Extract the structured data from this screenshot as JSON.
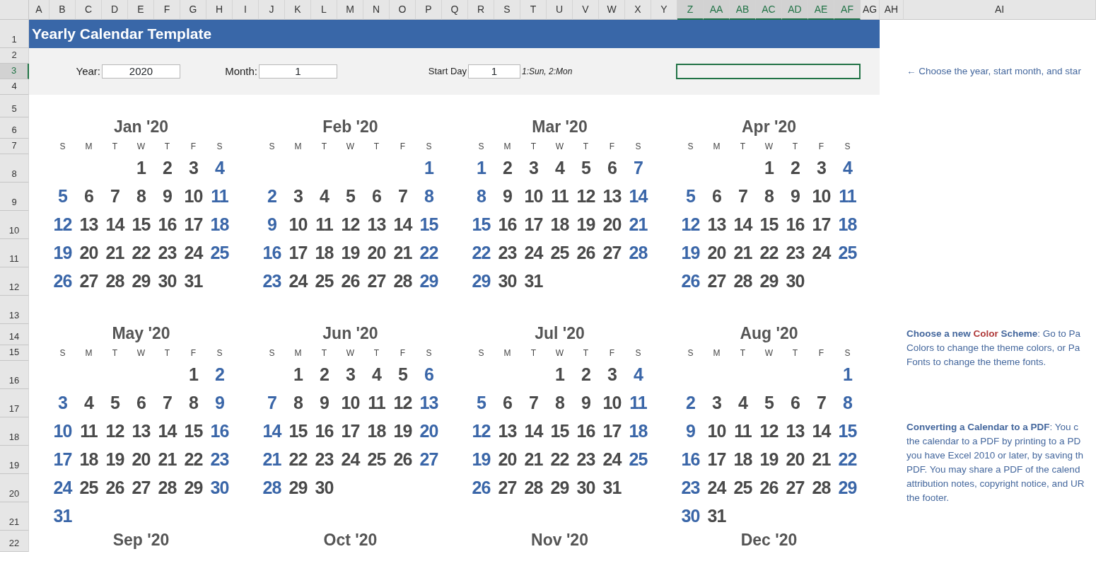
{
  "sheet": {
    "columns": [
      {
        "label": "A",
        "selected": false
      },
      {
        "label": "B",
        "selected": false
      },
      {
        "label": "C",
        "selected": false
      },
      {
        "label": "D",
        "selected": false
      },
      {
        "label": "E",
        "selected": false
      },
      {
        "label": "F",
        "selected": false
      },
      {
        "label": "G",
        "selected": false
      },
      {
        "label": "H",
        "selected": false
      },
      {
        "label": "I",
        "selected": false
      },
      {
        "label": "J",
        "selected": false
      },
      {
        "label": "K",
        "selected": false
      },
      {
        "label": "L",
        "selected": false
      },
      {
        "label": "M",
        "selected": false
      },
      {
        "label": "N",
        "selected": false
      },
      {
        "label": "O",
        "selected": false
      },
      {
        "label": "P",
        "selected": false
      },
      {
        "label": "Q",
        "selected": false
      },
      {
        "label": "R",
        "selected": false
      },
      {
        "label": "S",
        "selected": false
      },
      {
        "label": "T",
        "selected": false
      },
      {
        "label": "U",
        "selected": false
      },
      {
        "label": "V",
        "selected": false
      },
      {
        "label": "W",
        "selected": false
      },
      {
        "label": "X",
        "selected": false
      },
      {
        "label": "Y",
        "selected": false
      },
      {
        "label": "Z",
        "selected": true
      },
      {
        "label": "AA",
        "selected": true
      },
      {
        "label": "AB",
        "selected": true
      },
      {
        "label": "AC",
        "selected": true
      },
      {
        "label": "AD",
        "selected": true
      },
      {
        "label": "AE",
        "selected": true
      },
      {
        "label": "AF",
        "selected": true
      },
      {
        "label": "AG",
        "selected": false
      },
      {
        "label": "AH",
        "selected": false
      },
      {
        "label": "AI",
        "selected": false
      }
    ],
    "rows": [
      {
        "label": "1",
        "selected": false
      },
      {
        "label": "2",
        "selected": false
      },
      {
        "label": "3",
        "selected": true
      },
      {
        "label": "4",
        "selected": false
      },
      {
        "label": "5",
        "selected": false
      },
      {
        "label": "6",
        "selected": false
      },
      {
        "label": "7",
        "selected": false
      },
      {
        "label": "8",
        "selected": false
      },
      {
        "label": "9",
        "selected": false
      },
      {
        "label": "10",
        "selected": false
      },
      {
        "label": "11",
        "selected": false
      },
      {
        "label": "12",
        "selected": false
      },
      {
        "label": "13",
        "selected": false
      },
      {
        "label": "14",
        "selected": false
      },
      {
        "label": "15",
        "selected": false
      },
      {
        "label": "16",
        "selected": false
      },
      {
        "label": "17",
        "selected": false
      },
      {
        "label": "18",
        "selected": false
      },
      {
        "label": "19",
        "selected": false
      },
      {
        "label": "20",
        "selected": false
      },
      {
        "label": "21",
        "selected": false
      },
      {
        "label": "22",
        "selected": false
      }
    ]
  },
  "title": "Yearly Calendar Template",
  "inputs": [
    {
      "label": "Year:",
      "value": "2020"
    },
    {
      "label": "Month:",
      "value": "1"
    },
    {
      "label": "Start Day",
      "value": "1",
      "hint": "1:Sun, 2:Mon"
    }
  ],
  "notes": [
    {
      "parts": [
        {
          "text": "← Choose the year, start month, and star"
        }
      ]
    },
    {
      "lines": [
        {
          "parts": [
            {
              "text": "Choose a new ",
              "kind": "bold"
            },
            {
              "text": "Color",
              "kind": "accent"
            },
            {
              "text": " Scheme",
              "kind": "bold"
            },
            {
              "text": ": Go to Pa"
            }
          ]
        },
        {
          "parts": [
            {
              "text": "Colors to change the theme colors, or Pa"
            }
          ]
        },
        {
          "parts": [
            {
              "text": "Fonts to change the theme fonts."
            }
          ]
        }
      ]
    },
    {
      "lines": [
        {
          "parts": [
            {
              "text": "Converting a Calendar to a PDF",
              "kind": "bold"
            },
            {
              "text": ": You c"
            }
          ]
        },
        {
          "parts": [
            {
              "text": "the calendar to a PDF by printing to a PD"
            }
          ]
        },
        {
          "parts": [
            {
              "text": "you have Excel 2010 or later, by saving th"
            }
          ]
        },
        {
          "parts": [
            {
              "text": "PDF. You may share a PDF of the calend"
            }
          ]
        },
        {
          "parts": [
            {
              "text": "attribution notes, copyright notice, and UR"
            }
          ]
        },
        {
          "parts": [
            {
              "text": "the footer."
            }
          ]
        }
      ]
    }
  ],
  "months": [
    {
      "title": "Jan '20",
      "weekdays": [
        "S",
        "M",
        "T",
        "W",
        "T",
        "F",
        "S"
      ],
      "weeks": [
        {
          "kind": "first",
          "days": [
            "1",
            "2",
            "3",
            "4"
          ]
        },
        {
          "kind": "regular",
          "days": [
            "5",
            "6",
            "7",
            "8",
            "9",
            "10",
            "11"
          ]
        },
        {
          "kind": "regular",
          "days": [
            "12",
            "13",
            "14",
            "15",
            "16",
            "17",
            "18"
          ]
        },
        {
          "kind": "regular",
          "days": [
            "19",
            "20",
            "21",
            "22",
            "23",
            "24",
            "25"
          ]
        },
        {
          "kind": "regular",
          "days": [
            "26",
            "27",
            "28",
            "29",
            "30",
            "31"
          ]
        }
      ]
    },
    {
      "title": "Feb '20",
      "weekdays": [
        "S",
        "M",
        "T",
        "W",
        "T",
        "F",
        "S"
      ],
      "weeks": [
        {
          "kind": "first",
          "days": [
            "1"
          ]
        },
        {
          "kind": "regular",
          "days": [
            "2",
            "3",
            "4",
            "5",
            "6",
            "7",
            "8"
          ]
        },
        {
          "kind": "regular",
          "days": [
            "9",
            "10",
            "11",
            "12",
            "13",
            "14",
            "15"
          ]
        },
        {
          "kind": "regular",
          "days": [
            "16",
            "17",
            "18",
            "19",
            "20",
            "21",
            "22"
          ]
        },
        {
          "kind": "regular",
          "days": [
            "23",
            "24",
            "25",
            "26",
            "27",
            "28",
            "29"
          ]
        }
      ]
    },
    {
      "title": "Mar '20",
      "weekdays": [
        "S",
        "M",
        "T",
        "W",
        "T",
        "F",
        "S"
      ],
      "weeks": [
        {
          "kind": "first",
          "days": [
            "1",
            "2",
            "3",
            "4",
            "5",
            "6",
            "7"
          ]
        },
        {
          "kind": "regular",
          "days": [
            "8",
            "9",
            "10",
            "11",
            "12",
            "13",
            "14"
          ]
        },
        {
          "kind": "regular",
          "days": [
            "15",
            "16",
            "17",
            "18",
            "19",
            "20",
            "21"
          ]
        },
        {
          "kind": "regular",
          "days": [
            "22",
            "23",
            "24",
            "25",
            "26",
            "27",
            "28"
          ]
        },
        {
          "kind": "regular",
          "days": [
            "29",
            "30",
            "31"
          ]
        }
      ]
    },
    {
      "title": "Apr '20",
      "weekdays": [
        "S",
        "M",
        "T",
        "W",
        "T",
        "F",
        "S"
      ],
      "weeks": [
        {
          "kind": "first",
          "days": [
            "1",
            "2",
            "3",
            "4"
          ]
        },
        {
          "kind": "regular",
          "days": [
            "5",
            "6",
            "7",
            "8",
            "9",
            "10",
            "11"
          ]
        },
        {
          "kind": "regular",
          "days": [
            "12",
            "13",
            "14",
            "15",
            "16",
            "17",
            "18"
          ]
        },
        {
          "kind": "regular",
          "days": [
            "19",
            "20",
            "21",
            "22",
            "23",
            "24",
            "25"
          ]
        },
        {
          "kind": "regular",
          "days": [
            "26",
            "27",
            "28",
            "29",
            "30"
          ]
        }
      ]
    },
    {
      "title": "May '20",
      "weekdays": [
        "S",
        "M",
        "T",
        "W",
        "T",
        "F",
        "S"
      ],
      "weeks": [
        {
          "kind": "first",
          "days": [
            "1",
            "2"
          ]
        },
        {
          "kind": "regular",
          "days": [
            "3",
            "4",
            "5",
            "6",
            "7",
            "8",
            "9"
          ]
        },
        {
          "kind": "regular",
          "days": [
            "10",
            "11",
            "12",
            "13",
            "14",
            "15",
            "16"
          ]
        },
        {
          "kind": "regular",
          "days": [
            "17",
            "18",
            "19",
            "20",
            "21",
            "22",
            "23"
          ]
        },
        {
          "kind": "regular",
          "days": [
            "24",
            "25",
            "26",
            "27",
            "28",
            "29",
            "30"
          ]
        },
        {
          "kind": "regular",
          "days": [
            "31"
          ]
        }
      ]
    },
    {
      "title": "Jun '20",
      "weekdays": [
        "S",
        "M",
        "T",
        "W",
        "T",
        "F",
        "S"
      ],
      "weeks": [
        {
          "kind": "first",
          "days": [
            "1",
            "2",
            "3",
            "4",
            "5",
            "6"
          ]
        },
        {
          "kind": "regular",
          "days": [
            "7",
            "8",
            "9",
            "10",
            "11",
            "12",
            "13"
          ]
        },
        {
          "kind": "regular",
          "days": [
            "14",
            "15",
            "16",
            "17",
            "18",
            "19",
            "20"
          ]
        },
        {
          "kind": "regular",
          "days": [
            "21",
            "22",
            "23",
            "24",
            "25",
            "26",
            "27"
          ]
        },
        {
          "kind": "regular",
          "days": [
            "28",
            "29",
            "30"
          ]
        }
      ]
    },
    {
      "title": "Jul '20",
      "weekdays": [
        "S",
        "M",
        "T",
        "W",
        "T",
        "F",
        "S"
      ],
      "weeks": [
        {
          "kind": "first",
          "days": [
            "1",
            "2",
            "3",
            "4"
          ]
        },
        {
          "kind": "regular",
          "days": [
            "5",
            "6",
            "7",
            "8",
            "9",
            "10",
            "11"
          ]
        },
        {
          "kind": "regular",
          "days": [
            "12",
            "13",
            "14",
            "15",
            "16",
            "17",
            "18"
          ]
        },
        {
          "kind": "regular",
          "days": [
            "19",
            "20",
            "21",
            "22",
            "23",
            "24",
            "25"
          ]
        },
        {
          "kind": "regular",
          "days": [
            "26",
            "27",
            "28",
            "29",
            "30",
            "31"
          ]
        }
      ]
    },
    {
      "title": "Aug '20",
      "weekdays": [
        "S",
        "M",
        "T",
        "W",
        "T",
        "F",
        "S"
      ],
      "weeks": [
        {
          "kind": "first",
          "days": [
            "1"
          ]
        },
        {
          "kind": "regular",
          "days": [
            "2",
            "3",
            "4",
            "5",
            "6",
            "7",
            "8"
          ]
        },
        {
          "kind": "regular",
          "days": [
            "9",
            "10",
            "11",
            "12",
            "13",
            "14",
            "15"
          ]
        },
        {
          "kind": "regular",
          "days": [
            "16",
            "17",
            "18",
            "19",
            "20",
            "21",
            "22"
          ]
        },
        {
          "kind": "regular",
          "days": [
            "23",
            "24",
            "25",
            "26",
            "27",
            "28",
            "29"
          ]
        },
        {
          "kind": "regular",
          "days": [
            "30",
            "31"
          ]
        }
      ]
    },
    {
      "title": "Sep '20"
    },
    {
      "title": "Oct '20"
    },
    {
      "title": "Nov '20"
    },
    {
      "title": "Dec '20"
    }
  ]
}
